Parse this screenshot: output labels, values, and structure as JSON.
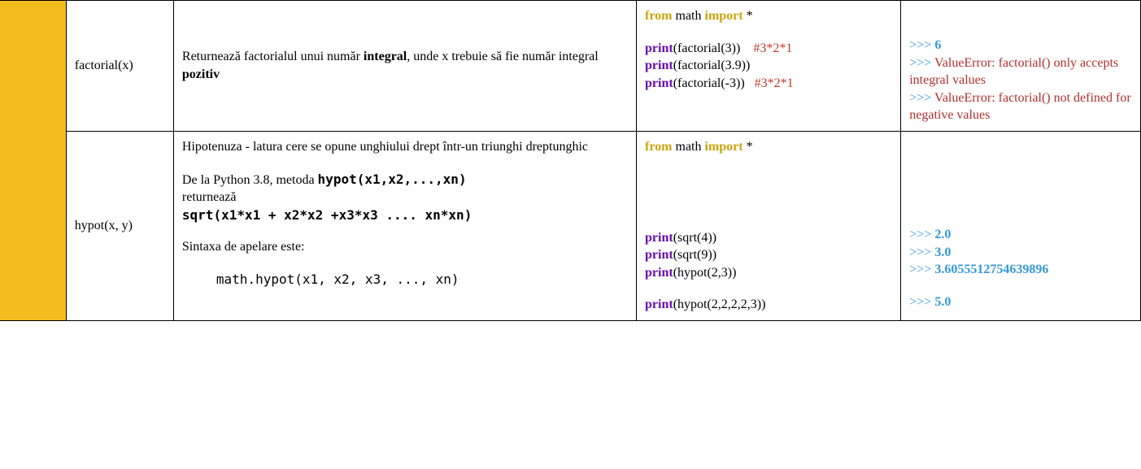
{
  "rows": [
    {
      "func": "factorial(x)",
      "desc": {
        "t1": "Returnează factorialul unui număr ",
        "b1": "integral",
        "t2": ", unde x trebuie să fie număr integral ",
        "b2": "pozitiv"
      },
      "code": {
        "from": "from",
        "math": " math ",
        "import": "import",
        "star": " *",
        "lines": [
          {
            "p": "print",
            "args": "(factorial(3))",
            "pad": "    ",
            "c": "#3*2*1"
          },
          {
            "p": "print",
            "args": "(factorial(3.9))",
            "pad": "",
            "c": ""
          },
          {
            "p": "print",
            "args": "(factorial(-3))",
            "pad": "   ",
            "c": "#3*2*1"
          }
        ]
      },
      "output": {
        "l1_prompt": ">>> ",
        "l1_val": "6",
        "l2_prompt": ">>> ",
        "l2_err": "ValueError: factorial() only accepts integral values",
        "l3_prompt": ">>> ",
        "l3_err": "ValueError: factorial() not defined for negative values"
      }
    },
    {
      "func": "hypot(x, y)",
      "desc": {
        "t1": "Hipotenuza - latura cere se opune unghiului drept într-un triunghi dreptunghic",
        "t2a": "De la Python 3.8, metoda ",
        "b1": "hypot(x1,x2,...,xn)",
        "t2b": "returnează",
        "b2": "sqrt(x1*x1 + x2*x2 +x3*x3 .... xn*xn)",
        "t3": "Sintaxa de apelare este:",
        "syntax": "math.hypot(x1, x2, x3, ..., xn)"
      },
      "code": {
        "from": "from",
        "math": " math ",
        "import": "import",
        "star": " *",
        "lines": [
          {
            "p": "print",
            "args": "(sqrt(4))"
          },
          {
            "p": "print",
            "args": "(sqrt(9))"
          },
          {
            "p": "print",
            "args": "(hypot(2,3))"
          }
        ],
        "lastline": {
          "p": "print",
          "args": "(hypot(2,2,2,2,3))"
        }
      },
      "output": {
        "l1_prompt": ">>> ",
        "l1_val": "2.0",
        "l2_prompt": ">>> ",
        "l2_val": "3.0",
        "l3_prompt": ">>> ",
        "l3_val": "3.6055512754639896",
        "l4_prompt": ">>> ",
        "l4_val": "5.0"
      }
    }
  ]
}
